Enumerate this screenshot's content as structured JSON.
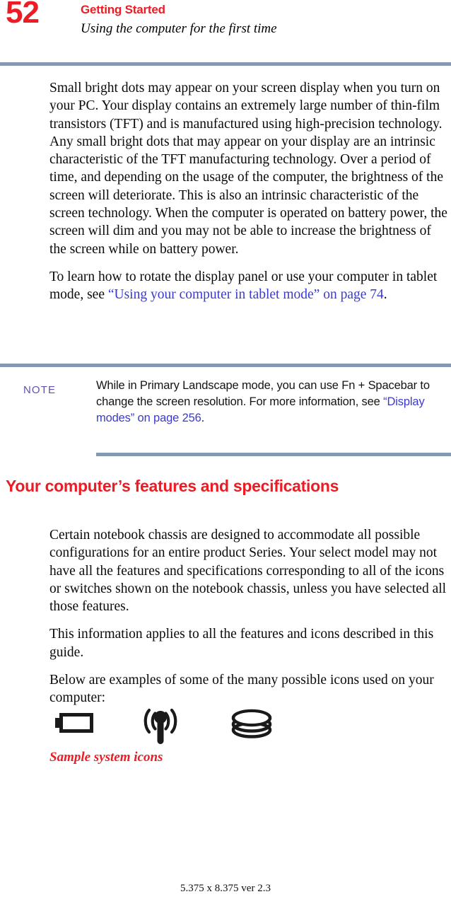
{
  "header": {
    "page_number": "52",
    "chapter_title": "Getting Started",
    "section_title": "Using the computer for the first time"
  },
  "body": {
    "paragraph_1": "Small bright dots may appear on your screen display when you turn on your PC. Your display contains an extremely large number of thin-film transistors (TFT) and is manufactured using high-precision technology. Any small bright dots that may appear on your display are an intrinsic characteristic of the TFT manufacturing technology. Over a period of time, and depending on the usage of the computer, the brightness of the screen will deteriorate. This is also an intrinsic characteristic of the screen technology. When the computer is operated on battery power, the screen will dim and you may not be able to increase the brightness of the screen while on battery power.",
    "paragraph_2_before_link": "To learn how to rotate the display panel or use your computer in tablet mode, see ",
    "paragraph_2_link": "“Using your computer in tablet mode” on page 74",
    "paragraph_2_after_link": "."
  },
  "note": {
    "label": "NOTE",
    "text_before_link": "While in Primary Landscape mode, you can use Fn + Spacebar to change the screen resolution. For more information, see ",
    "link": "“Display modes” on page 256",
    "text_after_link": "."
  },
  "section": {
    "heading": "Your computer’s features and specifications",
    "paragraph_1": "Certain notebook chassis are designed to accommodate all possible configurations for an entire product Series. Your select model may not have all the features and specifications corresponding to all of the icons or switches shown on the notebook chassis, unless you have selected all those features.",
    "paragraph_2": "This information applies to all the features and icons described in this guide.",
    "paragraph_3": "Below are examples of some of the many possible icons used on your computer:"
  },
  "icons": {
    "items": [
      {
        "name": "battery-icon",
        "label": "battery"
      },
      {
        "name": "wireless-antenna-icon",
        "label": "wireless antenna"
      },
      {
        "name": "hard-disk-drive-icon",
        "label": "hard disk drive"
      }
    ],
    "caption": "Sample system icons"
  },
  "footer": {
    "text": "5.375 x 8.375 ver 2.3"
  },
  "colors": {
    "accent_red": "#ed1c24",
    "rule_slate": "#8399b0",
    "link_blue": "#3a3ad0",
    "note_purple": "#6054a6"
  }
}
